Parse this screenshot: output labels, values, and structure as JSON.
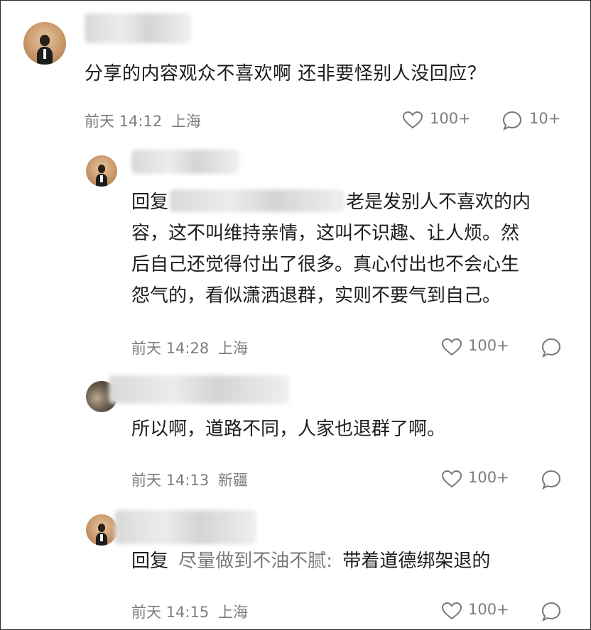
{
  "comments": [
    {
      "text": "分享的内容观众不喜欢啊 还非要怪别人没回应？",
      "time": "前天 14:12",
      "location": "上海",
      "likes": "100+",
      "replies": "10+"
    },
    {
      "reply_word": "回复",
      "body_lines": [
        "老是发别人不喜欢的内",
        "容，这不叫维持亲情，这叫不识趣、让人烦。然",
        "后自己还觉得付出了很多。真心付出也不会心生",
        "怨气的，看似潇洒退群，实则不要气到自己。"
      ],
      "time": "前天 14:28",
      "location": "上海",
      "likes": "100+"
    },
    {
      "text": "所以啊，道路不同，人家也退群了啊。",
      "time": "前天 14:13",
      "location": "新疆",
      "likes": "100+"
    },
    {
      "reply_word": "回复",
      "reply_target": "尽量做到不油不腻:",
      "text": "带着道德绑架退的",
      "time": "前天 14:15",
      "location": "上海",
      "likes": "100+"
    }
  ]
}
